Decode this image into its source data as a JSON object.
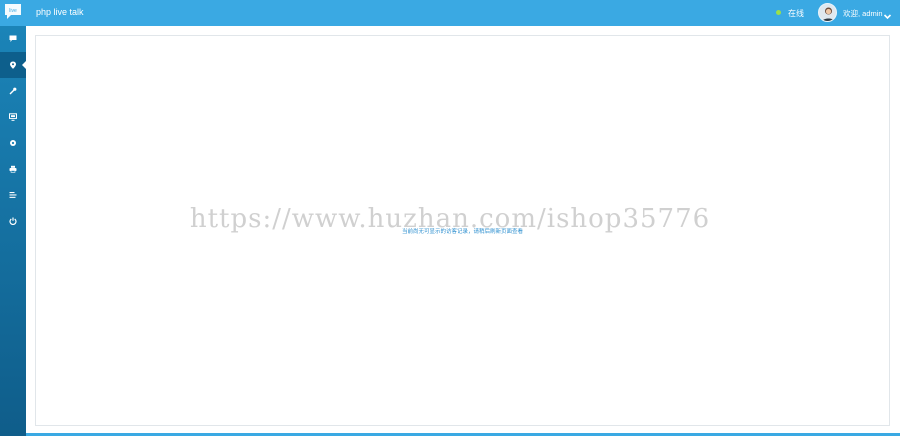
{
  "header": {
    "app_title": "php live talk",
    "status_label": "在线",
    "welcome_text": "欢迎, admin",
    "status_color": "#9be04a",
    "accent_color": "#3aa9e3"
  },
  "sidebar": {
    "items": [
      {
        "icon": "chat-icon"
      },
      {
        "icon": "location-pin-icon",
        "active": true
      },
      {
        "icon": "wrench-icon"
      },
      {
        "icon": "monitor-icon"
      },
      {
        "icon": "gear-icon"
      },
      {
        "icon": "printer-icon"
      },
      {
        "icon": "list-icon"
      },
      {
        "icon": "power-icon"
      }
    ]
  },
  "main": {
    "notice": "当前尚无可显示的访客记录，请稍后刷新页面查看"
  },
  "watermark": "https://www.huzhan.com/ishop35776"
}
